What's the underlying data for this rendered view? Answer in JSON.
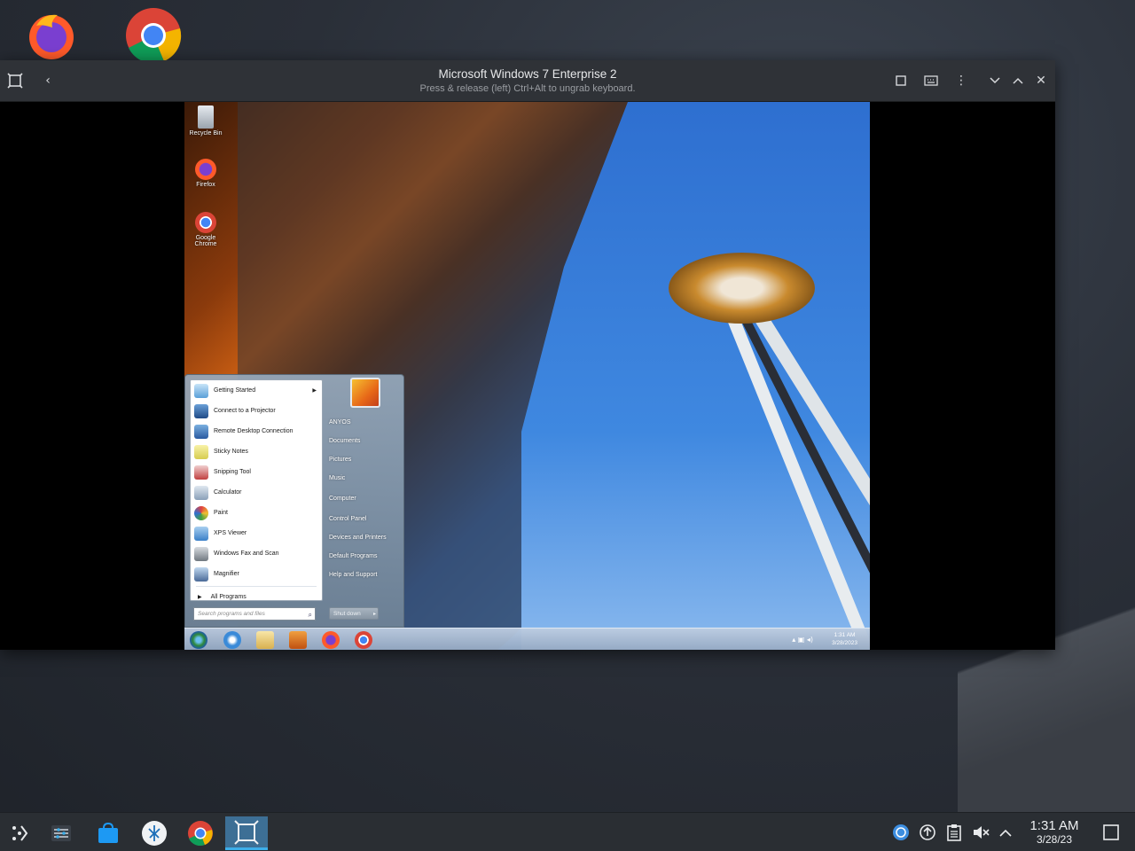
{
  "host": {
    "desktop_icons": [
      "firefox-icon",
      "chrome-icon"
    ],
    "taskbar": {
      "clock_time": "1:31 AM",
      "clock_date": "3/28/23",
      "apps": [
        "app-launcher-icon",
        "settings-icon",
        "store-icon",
        "remote-icon",
        "chrome-icon",
        "vm-icon"
      ]
    }
  },
  "vm_window": {
    "title": "Microsoft Windows 7 Enterprise 2",
    "subtitle": "Press & release (left) Ctrl+Alt to ungrab keyboard."
  },
  "guest": {
    "desktop_icons": [
      {
        "label": "Recycle Bin"
      },
      {
        "label": "Firefox"
      },
      {
        "label": "Google Chrome"
      }
    ],
    "start_menu": {
      "left_items": [
        {
          "label": "Getting Started"
        },
        {
          "label": "Connect to a Projector"
        },
        {
          "label": "Remote Desktop Connection"
        },
        {
          "label": "Sticky Notes"
        },
        {
          "label": "Snipping Tool"
        },
        {
          "label": "Calculator"
        },
        {
          "label": "Paint"
        },
        {
          "label": "XPS Viewer"
        },
        {
          "label": "Windows Fax and Scan"
        },
        {
          "label": "Magnifier"
        }
      ],
      "all_programs": "All Programs",
      "search_placeholder": "Search programs and files",
      "right_items": [
        {
          "label": "ANYOS"
        },
        {
          "label": "Documents"
        },
        {
          "label": "Pictures"
        },
        {
          "label": "Music"
        },
        {
          "label": "Computer"
        },
        {
          "label": "Control Panel"
        },
        {
          "label": "Devices and Printers"
        },
        {
          "label": "Default Programs"
        },
        {
          "label": "Help and Support"
        }
      ],
      "shutdown_label": "Shut down"
    },
    "taskbar": {
      "clock_time": "1:31 AM",
      "clock_date": "3/28/2023"
    }
  }
}
